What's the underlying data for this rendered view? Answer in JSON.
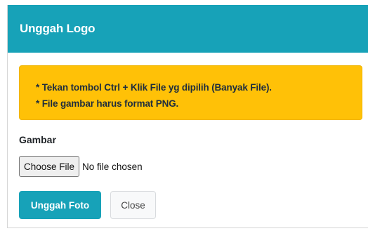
{
  "modal": {
    "title": "Unggah Logo",
    "alert": {
      "lines": [
        "* Tekan tombol Ctrl + Klik File yg dipilih (Banyak File).",
        "* File gambar harus format PNG."
      ],
      "color": "#ffc107"
    },
    "form": {
      "label": "Gambar",
      "file_button": "Choose File",
      "file_status": "No file chosen"
    },
    "buttons": {
      "upload": "Unggah Foto",
      "close": "Close"
    },
    "colors": {
      "header": "#17a2b8",
      "primary": "#17a2b8"
    }
  }
}
